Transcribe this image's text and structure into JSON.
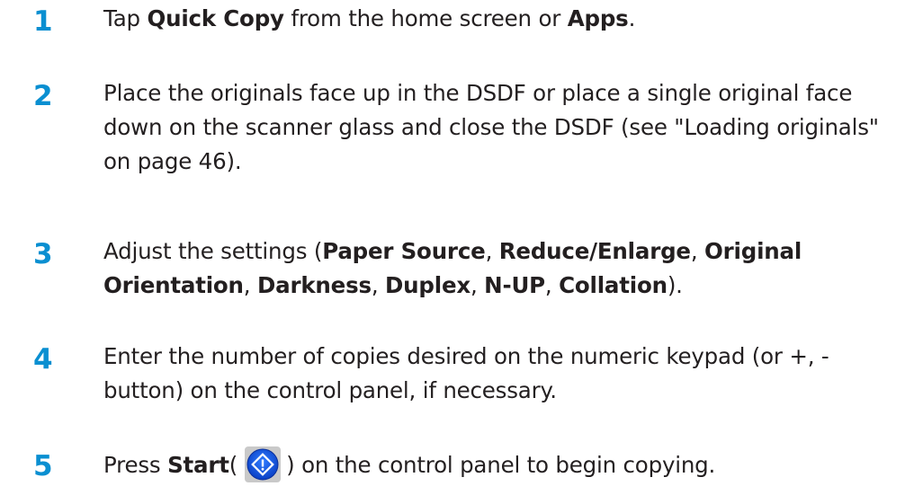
{
  "steps": [
    {
      "number": "1",
      "text": {
        "t1": "Tap ",
        "b1": "Quick Copy",
        "t2": " from the home screen or ",
        "b2": "Apps",
        "t3": "."
      }
    },
    {
      "number": "2",
      "text": {
        "line1": "Place the originals face up in the DSDF or place a single original face",
        "line2": "down on the scanner glass and close the DSDF (see \"Loading originals\"",
        "line3": "on page 46)."
      }
    },
    {
      "number": "3",
      "text": {
        "t1": "Adjust the settings (",
        "b1": "Paper Source",
        "t2": ", ",
        "b2": "Reduce/Enlarge",
        "t3": ", ",
        "b3": "Original",
        "b4": "Orientation",
        "t4": ", ",
        "b5": "Darkness",
        "t5": ", ",
        "b6": "Duplex",
        "t6": ", ",
        "b7": "N-UP",
        "t7": ", ",
        "b8": "Collation",
        "t8": ")."
      }
    },
    {
      "number": "4",
      "text": {
        "line1": "Enter the number of copies desired on the numeric keypad (or +, -",
        "line2": "button) on the control panel, if necessary."
      }
    },
    {
      "number": "5",
      "text": {
        "t1": "Press ",
        "b1": "Start",
        "t2": "(",
        "icon": "start-button-icon",
        "t3": ") on the control panel to begin copying."
      }
    }
  ],
  "colors": {
    "step_number": "#0a8fd1",
    "body_text": "#231f20",
    "start_icon_outer": "#0b4fd8",
    "start_icon_inner": "#ffffff"
  }
}
